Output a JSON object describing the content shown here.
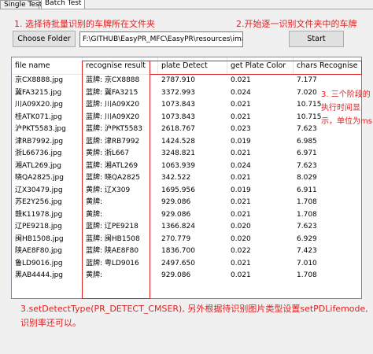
{
  "tabs": [
    {
      "label": "Single Test"
    },
    {
      "label": "Batch Test"
    }
  ],
  "annotations": {
    "a1": "1. 选择待批量识别的车牌所在文件夹",
    "a2": "2.开始逐一识别文件夹中的车牌",
    "a3_lines": [
      "3. 三个阶段的",
      "执行时间显",
      "示，单位为ms"
    ],
    "a4_lines": [
      "3.setDetectType(PR_DETECT_CMSER), 另外根据待识别图片类型设置setPDLifemode,",
      "识别率还可以。"
    ]
  },
  "toolbar": {
    "choose_folder_label": "Choose Folder",
    "folder_path_value": "F:\\GITHUB\\EasyPR_MFC\\EasyPR\\resources\\image",
    "start_label": "Start"
  },
  "table": {
    "columns": [
      "file name",
      "recognise result",
      "plate Detect",
      "get Plate Color",
      "chars Recognise"
    ],
    "rows": [
      {
        "file": "京CX8888.jpg",
        "result": "蓝牌: 京CX8888",
        "detect": "2787.910",
        "color": "0.021",
        "chars": "7.177"
      },
      {
        "file": "冀FA3215.jpg",
        "result": "蓝牌: 冀FA3215",
        "detect": "3372.993",
        "color": "0.024",
        "chars": "7.020"
      },
      {
        "file": "川A09X20.jpg",
        "result": "蓝牌: 川A09X20",
        "detect": "1073.843",
        "color": "0.021",
        "chars": "10.715"
      },
      {
        "file": "桂ATK071.jpg",
        "result": "蓝牌: 川A09X20",
        "detect": "1073.843",
        "color": "0.021",
        "chars": "10.715"
      },
      {
        "file": "沪PKT5583.jpg",
        "result": "蓝牌: 沪PKT5583",
        "detect": "2618.767",
        "color": "0.023",
        "chars": "7.623"
      },
      {
        "file": "津RB7992.jpg",
        "result": "蓝牌: 津RB7992",
        "detect": "1424.528",
        "color": "0.019",
        "chars": "6.985"
      },
      {
        "file": "浙L66736.jpg",
        "result": "黄牌: 浙L667",
        "detect": "3248.821",
        "color": "0.021",
        "chars": "6.971"
      },
      {
        "file": "湘ATL269.jpg",
        "result": "蓝牌: 湘ATL269",
        "detect": "1063.939",
        "color": "0.024",
        "chars": "7.623"
      },
      {
        "file": "晓QA2825.jpg",
        "result": "蓝牌: 晓QA2825",
        "detect": "342.522",
        "color": "0.021",
        "chars": "8.029"
      },
      {
        "file": "辽X30479.jpg",
        "result": "黄牌: 辽X309",
        "detect": "1695.956",
        "color": "0.019",
        "chars": "6.911"
      },
      {
        "file": "苏E2Y256.jpg",
        "result": "黄牌:",
        "detect": "929.086",
        "color": "0.021",
        "chars": "1.708"
      },
      {
        "file": "赣K11978.jpg",
        "result": "黄牌:",
        "detect": "929.086",
        "color": "0.021",
        "chars": "1.708"
      },
      {
        "file": "辽PE9218.jpg",
        "result": "蓝牌: 辽PE9218",
        "detect": "1366.824",
        "color": "0.020",
        "chars": "7.623"
      },
      {
        "file": "闽HB1508.jpg",
        "result": "蓝牌: 闽HB1508",
        "detect": "270.779",
        "color": "0.020",
        "chars": "6.929"
      },
      {
        "file": "陕AE8F80.jpg",
        "result": "蓝牌: 陕AE8F80",
        "detect": "1836.700",
        "color": "0.022",
        "chars": "7.423"
      },
      {
        "file": "鲁LD9016.jpg",
        "result": "蓝牌: 粤LD9016",
        "detect": "2497.650",
        "color": "0.021",
        "chars": "7.010"
      },
      {
        "file": "黑AB4444.jpg",
        "result": "黄牌:",
        "detect": "929.086",
        "color": "0.021",
        "chars": "1.708"
      }
    ]
  },
  "colors": {
    "annotation": "#e02020",
    "window_bg": "#f0f0f0"
  }
}
